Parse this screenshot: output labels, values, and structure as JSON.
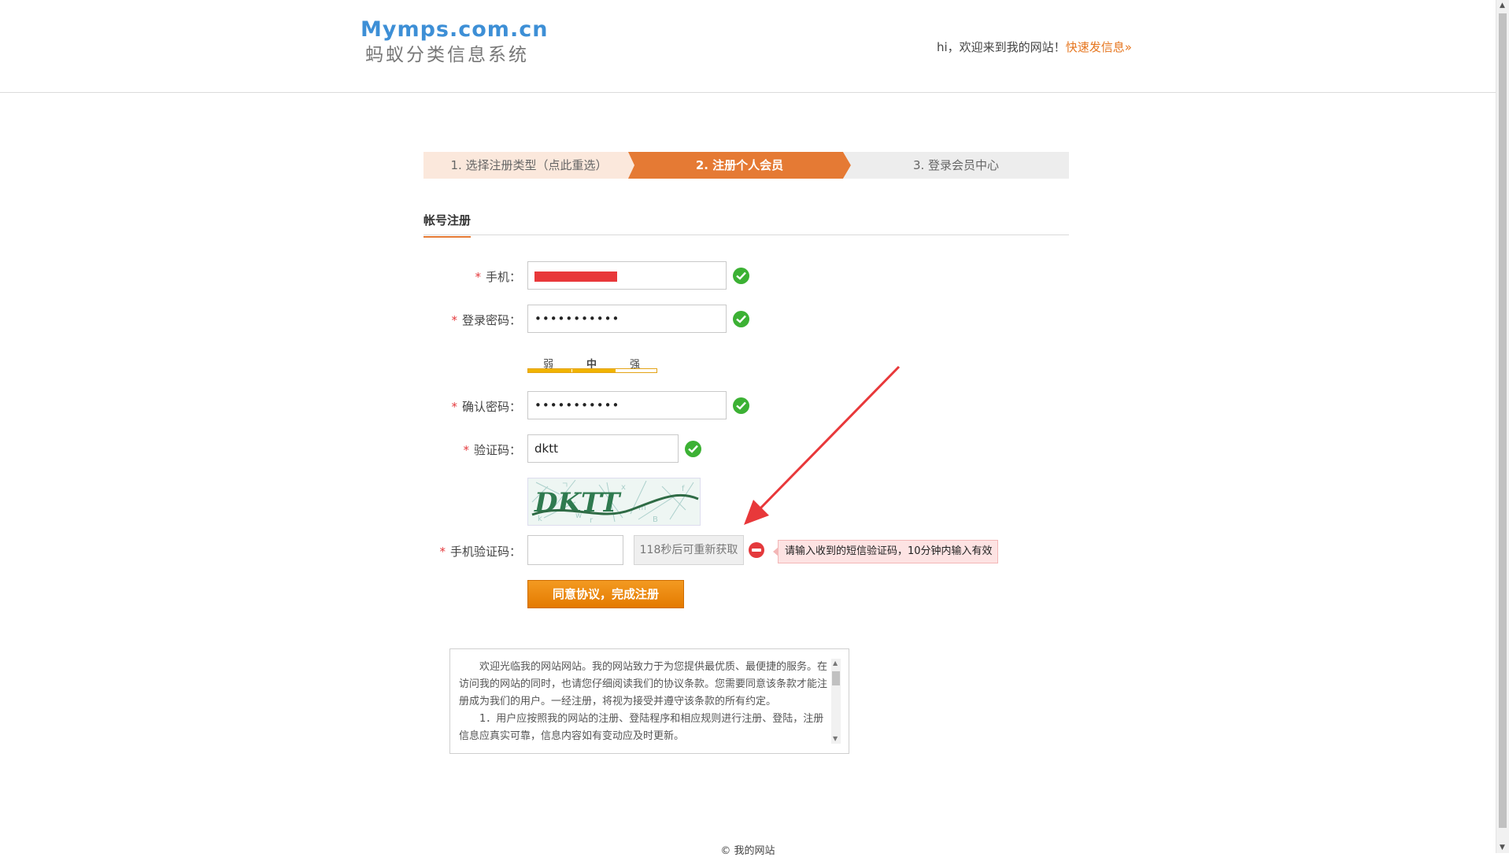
{
  "header": {
    "logo_en": "Mymps.com.cn",
    "logo_cn": "蚂蚁分类信息系统",
    "welcome": "hi，欢迎来到我的网站！",
    "post_link": "快速发信息»"
  },
  "steps": [
    {
      "label": "1. 选择注册类型（点此重选）"
    },
    {
      "label": "2. 注册个人会员"
    },
    {
      "label": "3. 登录会员中心"
    }
  ],
  "section_title": "帐号注册",
  "form": {
    "required_mark": "*",
    "phone": {
      "label": "手机："
    },
    "password": {
      "label": "登录密码：",
      "value": "•••••••••••"
    },
    "strength": {
      "weak": "弱",
      "medium": "中",
      "strong": "强",
      "level": "medium"
    },
    "confirm": {
      "label": "确认密码：",
      "value": "•••••••••••"
    },
    "captcha": {
      "label": "验证码：",
      "value": "dktt",
      "image_text": "DKTT"
    },
    "sms": {
      "label": "手机验证码：",
      "value": "",
      "resend": "118秒后可重新获取",
      "error": "请输入收到的短信验证码，10分钟内输入有效"
    },
    "submit": "同意协议，完成注册"
  },
  "agreement": {
    "p1": "欢迎光临我的网站网站。我的网站致力于为您提供最优质、最便捷的服务。在访问我的网站的同时，也请您仔细阅读我们的协议条款。您需要同意该条款才能注册成为我们的用户。一经注册，将视为接受并遵守该条款的所有约定。",
    "p2": "1．用户应按照我的网站的注册、登陆程序和相应规则进行注册、登陆，注册信息应真实可靠，信息内容如有变动应及时更新。"
  },
  "footer": "© 我的网站",
  "colors": {
    "accent": "#e57a34",
    "logo_blue": "#3d8fd6",
    "success": "#3cb134",
    "error": "#e4393c",
    "annotation_arrow": "#e8383a"
  }
}
